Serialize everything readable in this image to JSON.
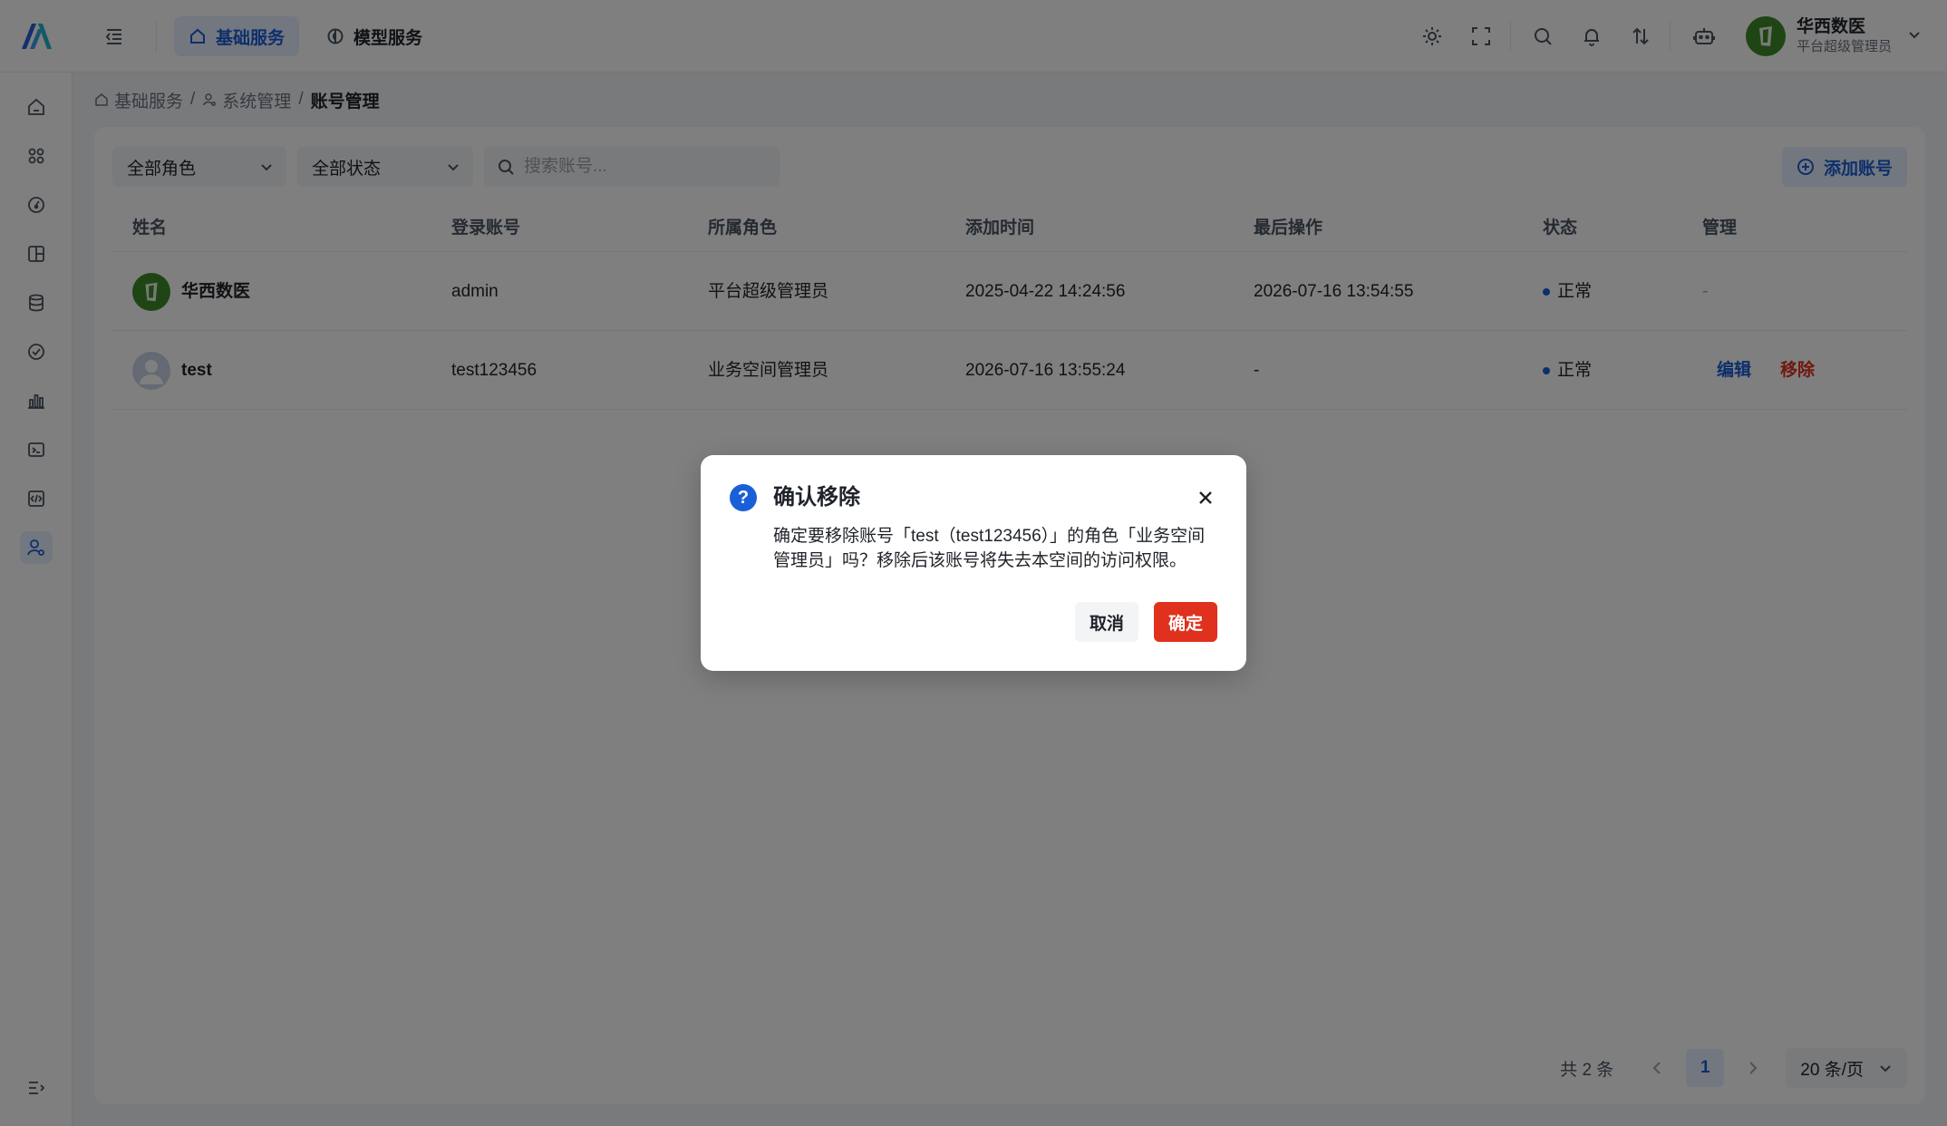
{
  "header": {
    "tabs": [
      {
        "label": "基础服务",
        "active": true
      },
      {
        "label": "模型服务",
        "active": false
      }
    ],
    "icons": [
      "sun-icon",
      "fullscreen-icon",
      "search-icon",
      "bell-icon",
      "swap-icon",
      "robot-icon"
    ],
    "user": {
      "name": "华西数医",
      "role": "平台超级管理员"
    }
  },
  "sidebar": {
    "items": [
      "home-icon",
      "apps-icon",
      "gauge-icon",
      "layout-icon",
      "database-icon",
      "check-circle-icon",
      "bar-chart-icon",
      "terminal-icon",
      "code-icon",
      "user-settings-icon"
    ],
    "active_index": 9
  },
  "breadcrumb": [
    {
      "label": "基础服务"
    },
    {
      "label": "系统管理"
    },
    {
      "label": "账号管理"
    }
  ],
  "filters": {
    "role": "全部角色",
    "status": "全部状态",
    "search_placeholder": "搜索账号...",
    "add_button": "添加账号"
  },
  "table": {
    "columns": [
      "姓名",
      "登录账号",
      "所属角色",
      "添加时间",
      "最后操作",
      "状态",
      "管理"
    ],
    "rows": [
      {
        "name": "华西数医",
        "account": "admin",
        "role": "平台超级管理员",
        "added": "2025-04-22 14:24:56",
        "last": "2026-07-16 13:54:55",
        "status": "正常",
        "manage": "-"
      },
      {
        "name": "test",
        "account": "test123456",
        "role": "业务空间管理员",
        "added": "2026-07-16 13:55:24",
        "last": "-",
        "status": "正常",
        "edit": "编辑",
        "remove": "移除"
      }
    ]
  },
  "pagination": {
    "total": "共 2 条",
    "current": "1",
    "page_size": "20 条/页"
  },
  "modal": {
    "title": "确认移除",
    "body": "确定要移除账号「test（test123456）」的角色「业务空间管理员」吗？移除后该账号将失去本空间的访问权限。",
    "cancel": "取消",
    "confirm": "确定"
  },
  "colors": {
    "accent": "#1a5fd7",
    "danger": "#e0301e",
    "brand_green": "#3f8a2b"
  }
}
